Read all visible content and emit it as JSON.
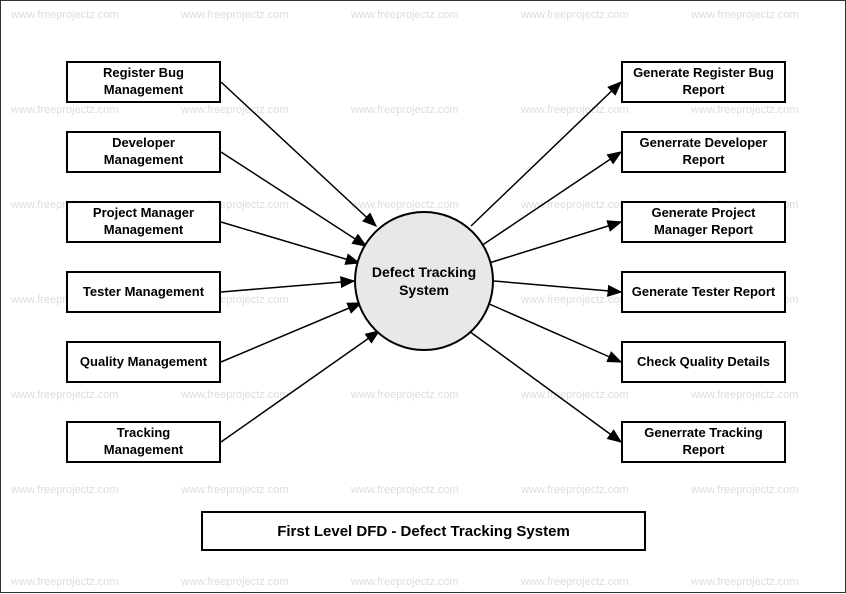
{
  "diagram_type": "Data Flow Diagram",
  "center": {
    "label": "Defect Tracking System"
  },
  "left_entities": [
    {
      "label": "Register Bug Management"
    },
    {
      "label": "Developer Management"
    },
    {
      "label": "Project Manager Management"
    },
    {
      "label": "Tester Management"
    },
    {
      "label": "Quality Management"
    },
    {
      "label": "Tracking Management"
    }
  ],
  "right_entities": [
    {
      "label": "Generate Register Bug Report"
    },
    {
      "label": "Generrate Developer Report"
    },
    {
      "label": "Generate Project Manager Report"
    },
    {
      "label": "Generate Tester Report"
    },
    {
      "label": "Check Quality Details"
    },
    {
      "label": "Generrate Tracking Report"
    }
  ],
  "title": "First Level DFD - Defect Tracking System",
  "watermark_text": "www.freeprojectz.com"
}
